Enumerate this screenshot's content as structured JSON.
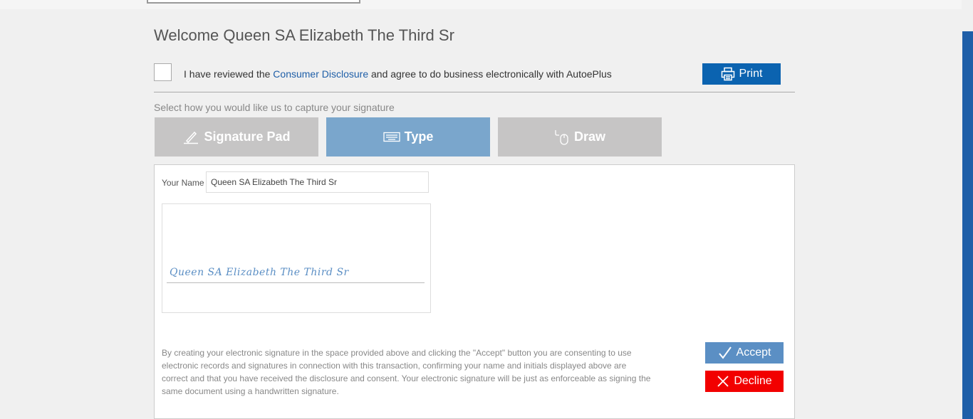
{
  "header": {
    "welcome": "Welcome Queen SA Elizabeth The Third Sr"
  },
  "consent": {
    "text_before": "I have reviewed the ",
    "link": "Consumer Disclosure",
    "text_after": " and agree to do business electronically with AutoePlus"
  },
  "toolbar": {
    "print_label": "Print",
    "print_icon": "printer-icon"
  },
  "capture": {
    "label": "Select how you would like us to capture your signature",
    "tabs": [
      {
        "label": "Signature Pad",
        "icon": "pen-icon",
        "selected": false
      },
      {
        "label": "Type",
        "icon": "keyboard-icon",
        "selected": true
      },
      {
        "label": "Draw",
        "icon": "mouse-icon",
        "selected": false
      }
    ]
  },
  "form": {
    "name_label": "Your Name",
    "name_value": "Queen SA Elizabeth The Third Sr",
    "signature_preview": "Queen SA Elizabeth The Third Sr"
  },
  "legal_text": "By creating your electronic signature in the space provided above and clicking the \"Accept\" button you are consenting to use electronic records and signatures in connection with this transaction, confirming your name and initials displayed above are correct and that you have received the disclosure and consent. Your electronic signature will be just as enforceable as signing the same document using a handwritten signature.",
  "actions": {
    "accept_label": "Accept",
    "decline_label": "Decline"
  },
  "colors": {
    "brand_blue": "#0b63b0",
    "selected_tab": "#7aa6cc",
    "inactive_tab": "#c6c5c5",
    "accept": "#5b8fc4",
    "decline": "#f20000"
  }
}
